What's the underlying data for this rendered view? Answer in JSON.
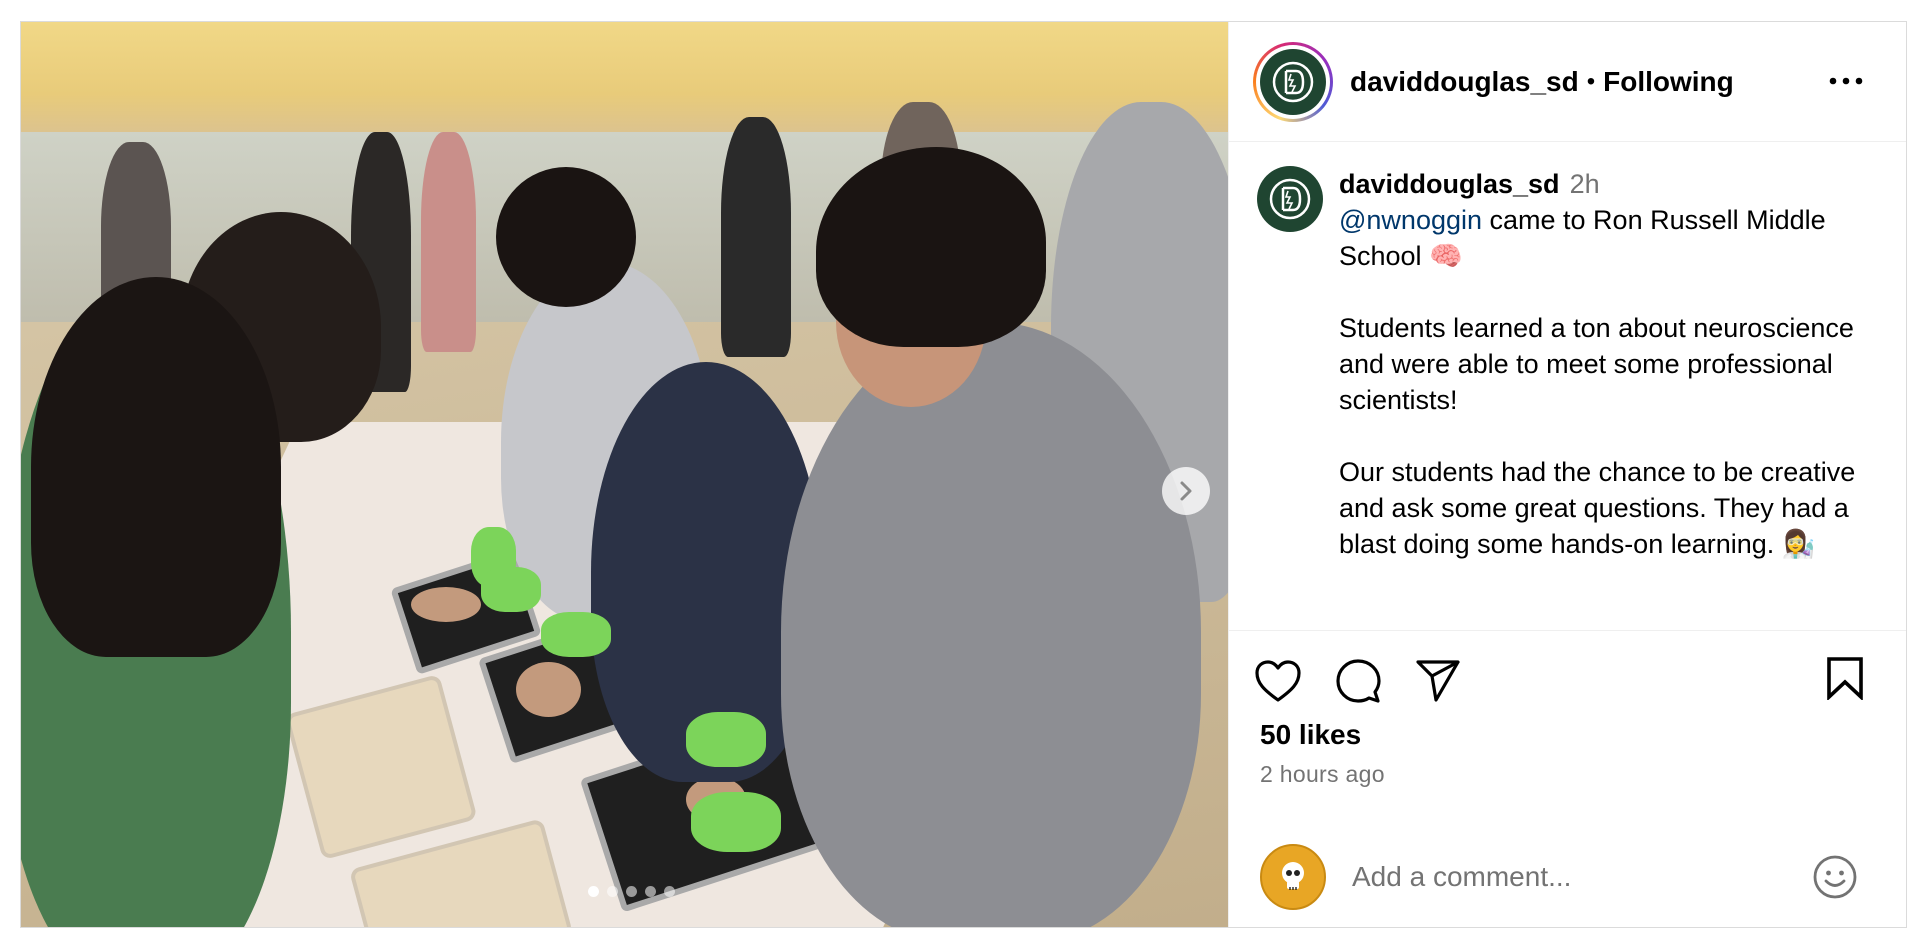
{
  "post": {
    "author": "daviddouglas_sd",
    "separator": "•",
    "follow_state": "Following",
    "more_icon": "more-horizontal-icon"
  },
  "media": {
    "photo_description_icon": "photo",
    "carousel": {
      "total": 5,
      "active_index": 0
    }
  },
  "caption": {
    "username": "daviddouglas_sd",
    "time": "2h",
    "mention": "@nwnoggin",
    "line1_rest": " came to Ron Russell Middle School 🧠",
    "para2": "Students learned a ton about neuroscience and were able to meet some professional scientists!",
    "para3": "Our students had the chance to be creative and ask some great questions. They had a blast doing some hands-on learning. 👩‍🔬"
  },
  "actions": {
    "like_icon": "heart-icon",
    "comment_icon": "comment-icon",
    "share_icon": "share-icon",
    "save_icon": "bookmark-icon"
  },
  "stats": {
    "likes": "50 likes",
    "posted_ago": "2 hours ago"
  },
  "comment": {
    "placeholder": "Add a comment...",
    "emoji_icon": "emoji-icon"
  },
  "colors": {
    "brand_green": "#1f4531",
    "mention_blue": "#00376b",
    "muted_text": "#737373",
    "border": "#dbdbdb"
  }
}
